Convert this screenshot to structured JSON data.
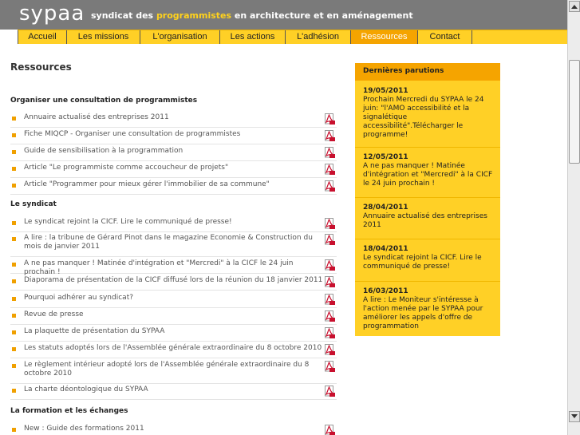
{
  "header": {
    "logo": "sypaa",
    "tagline_prefix": "syndicat des ",
    "tagline_highlight": "programmistes",
    "tagline_suffix": " en architecture et en aménagement"
  },
  "nav": [
    "Accueil",
    "Les missions",
    "L'organisation",
    "Les actions",
    "L'adhésion",
    "Ressources",
    "Contact"
  ],
  "nav_active": "Ressources",
  "page_title": "Ressources",
  "sections": [
    {
      "title": "Organiser une consultation de programmistes",
      "items": [
        "Annuaire actualisé des entreprises 2011",
        "Fiche MIQCP - Organiser une consultation de programmistes",
        "Guide de sensibilisation à la programmation",
        "Article \"Le programmiste comme accoucheur de projets\"",
        "Article \"Programmer pour mieux gérer l'immobilier de sa commune\""
      ]
    },
    {
      "title": "Le syndicat",
      "items": [
        "Le syndicat rejoint la CICF. Lire le communiqué de presse!",
        "A lire : la tribune de Gérard Pinot dans le magazine Economie & Construction du mois de janvier 2011",
        "A ne pas manquer ! Matinée d'intégration et \"Mercredi\" à la CICF le 24 juin prochain !",
        "Diaporama de présentation de la CICF diffusé lors de la réunion du 18 janvier 2011",
        "Pourquoi adhérer au syndicat?",
        "Revue de presse",
        "La plaquette de présentation du SYPAA",
        "Les statuts adoptés lors de l'Assemblée générale extraordinaire du 8 octobre 2010",
        "Le règlement intérieur adopté lors de l'Assemblée générale extraordinaire du 8 octobre 2010",
        "La charte déontologique du SYPAA"
      ]
    },
    {
      "title": "La formation et les échanges",
      "items": [
        "New : Guide des formations 2011"
      ]
    }
  ],
  "sidebar": {
    "title": "Dernières parutions",
    "news": [
      {
        "date": "19/05/2011",
        "text": "Prochain Mercredi du SYPAA le 24 juin: \"l'AMO accessibilité et la signalétique accessibilité\".Télécharger le programme!"
      },
      {
        "date": "12/05/2011",
        "text": "A ne pas manquer ! Matinée d'intégration et \"Mercredi\" à la CICF le 24 juin prochain !"
      },
      {
        "date": "28/04/2011",
        "text": "Annuaire actualisé des entreprises 2011"
      },
      {
        "date": "18/04/2011",
        "text": "Le syndicat rejoint la CICF. Lire le communiqué de presse!"
      },
      {
        "date": "16/03/2011",
        "text": "A lire : Le Moniteur s'intéresse à l'action menée par le SYPAA pour améliorer les appels d'offre de programmation"
      }
    ]
  },
  "colors": {
    "header_bg": "#7a7a7a",
    "accent_yellow": "#ffd026",
    "accent_orange": "#f5a400",
    "bullet": "#f0a000",
    "pdf_red": "#c8102e"
  },
  "icons": {
    "pdf": "pdf-icon",
    "scroll_up": "arrow-up-icon",
    "scroll_down": "arrow-down-icon"
  }
}
